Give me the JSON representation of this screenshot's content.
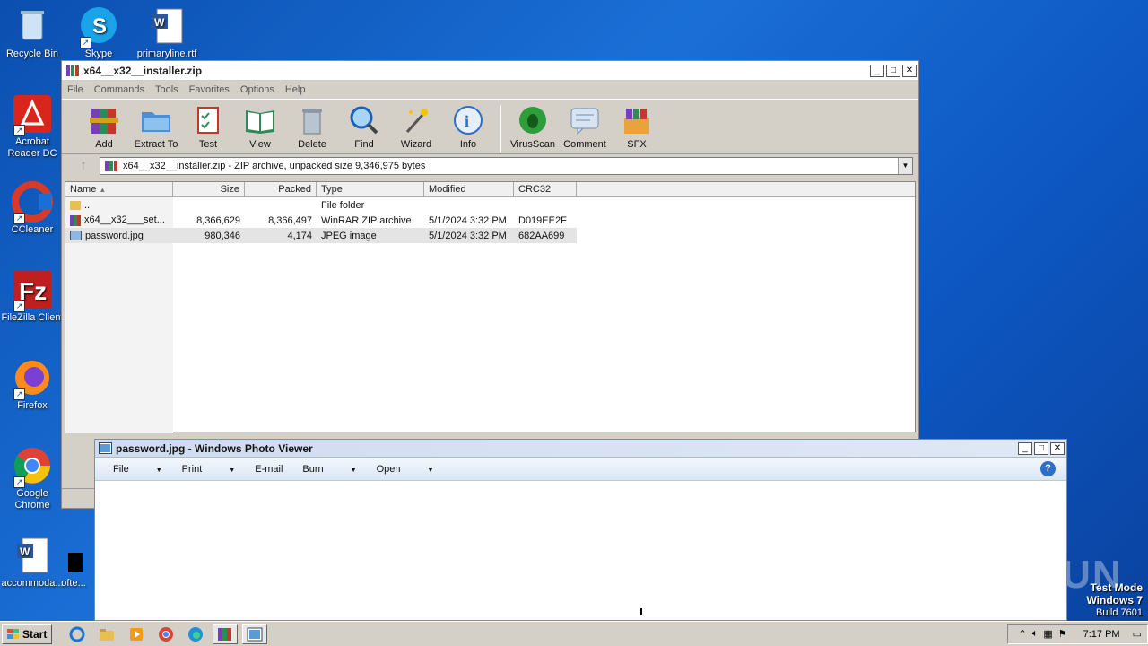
{
  "desktop": {
    "icons": [
      {
        "label": "Recycle Bin"
      },
      {
        "label": "Skype"
      },
      {
        "label": "primaryline.rtf"
      },
      {
        "label": "Acrobat Reader DC"
      },
      {
        "label": "CCleaner"
      },
      {
        "label": "FileZilla Client"
      },
      {
        "label": "Firefox"
      },
      {
        "label": "Google Chrome"
      },
      {
        "label": "accommoda..."
      },
      {
        "label": "ofte..."
      }
    ],
    "watermark": "ANY RUN",
    "test_mode": {
      "line1": "Test Mode",
      "line2": "Windows 7",
      "line3": "Build 7601"
    }
  },
  "winrar": {
    "title": "x64__x32__installer.zip",
    "menu": [
      "File",
      "Commands",
      "Tools",
      "Favorites",
      "Options",
      "Help"
    ],
    "toolbar": [
      "Add",
      "Extract To",
      "Test",
      "View",
      "Delete",
      "Find",
      "Wizard",
      "Info",
      "VirusScan",
      "Comment",
      "SFX"
    ],
    "address": "x64__x32__installer.zip - ZIP archive, unpacked size 9,346,975 bytes",
    "columns": [
      "Name",
      "Size",
      "Packed",
      "Type",
      "Modified",
      "CRC32"
    ],
    "rows": [
      {
        "name": "..",
        "size": "",
        "packed": "",
        "type": "File folder",
        "modified": "",
        "crc": ""
      },
      {
        "name": "x64__x32___set...",
        "size": "8,366,629",
        "packed": "8,366,497",
        "type": "WinRAR ZIP archive",
        "modified": "5/1/2024 3:32 PM",
        "crc": "D019EE2F"
      },
      {
        "name": "password.jpg",
        "size": "980,346",
        "packed": "4,174",
        "type": "JPEG image",
        "modified": "5/1/2024 3:32 PM",
        "crc": "682AA699"
      }
    ]
  },
  "viewer": {
    "title": "password.jpg - Windows Photo Viewer",
    "menu": [
      "File",
      "Print",
      "E-mail",
      "Burn",
      "Open"
    ]
  },
  "taskbar": {
    "start": "Start",
    "clock": "7:17 PM"
  }
}
